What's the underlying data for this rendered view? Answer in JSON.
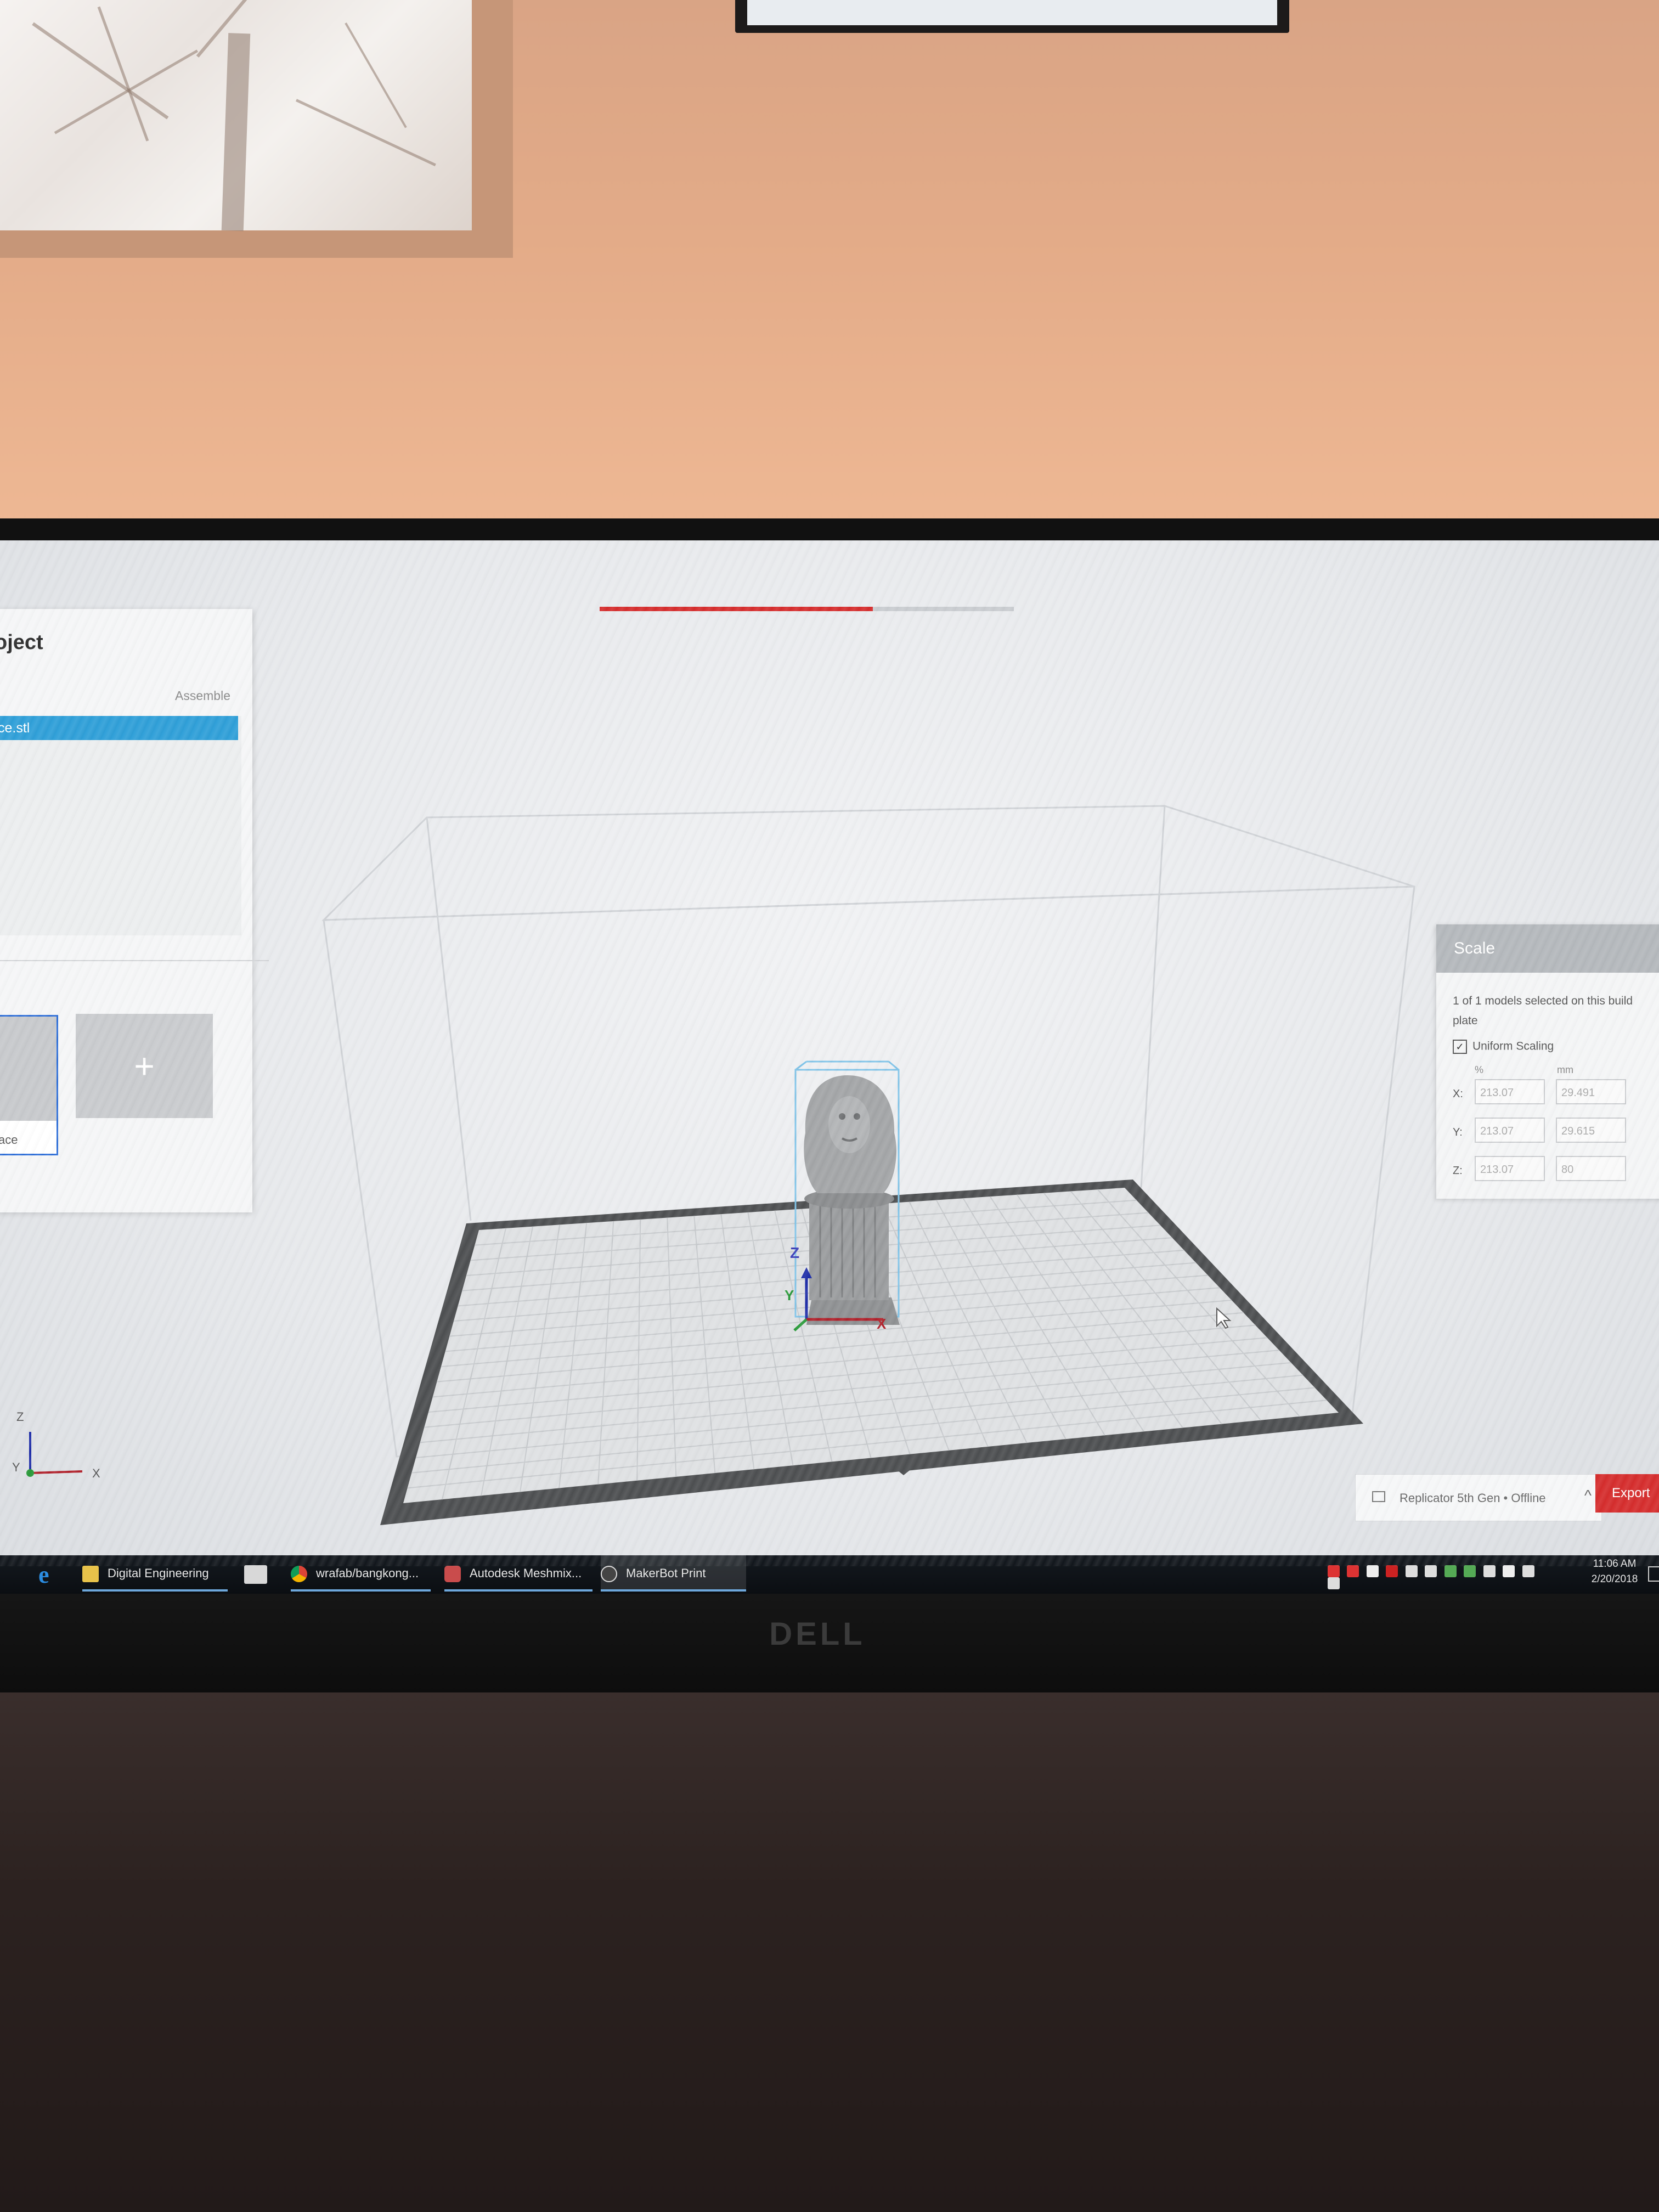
{
  "app": {
    "progress_percent": 66,
    "project": {
      "title": "oject",
      "assemble_label": "Assemble",
      "files": [
        "ce.stl"
      ],
      "plate_label": "ace",
      "add_plate_symbol": "+"
    },
    "scale": {
      "title": "Scale",
      "info": "1 of 1 models selected on this build plate",
      "uniform_label": "Uniform Scaling",
      "uniform_checked": true,
      "percent_header": "%",
      "mm_header": "mm",
      "rows": [
        {
          "axis": "X:",
          "percent": "213.07",
          "mm": "29.491"
        },
        {
          "axis": "Y:",
          "percent": "213.07",
          "mm": "29.615"
        },
        {
          "axis": "Z:",
          "percent": "213.07",
          "mm": "80"
        }
      ]
    },
    "printer": {
      "name": "Replicator 5th Gen • Offline",
      "chevron": "^"
    },
    "export_label": "Export",
    "axes": {
      "z": "Z",
      "y": "Y",
      "x": "X"
    },
    "colors": {
      "accent_red": "#d52d2d",
      "selection_blue": "#2f9fd8",
      "model_gray": "#9a9c9e"
    }
  },
  "taskbar": {
    "items": [
      {
        "label": "Digital Engineering",
        "icon": "folder-icon"
      },
      {
        "label": "wrafab/bangkong...",
        "icon": "chrome-icon"
      },
      {
        "label": "Autodesk Meshmix...",
        "icon": "meshmixer-icon"
      },
      {
        "label": "MakerBot Print",
        "icon": "makerbot-icon"
      }
    ],
    "clock_time": "11:06 AM",
    "clock_date": "2/20/2018"
  },
  "monitor": {
    "brand": "DELL"
  }
}
